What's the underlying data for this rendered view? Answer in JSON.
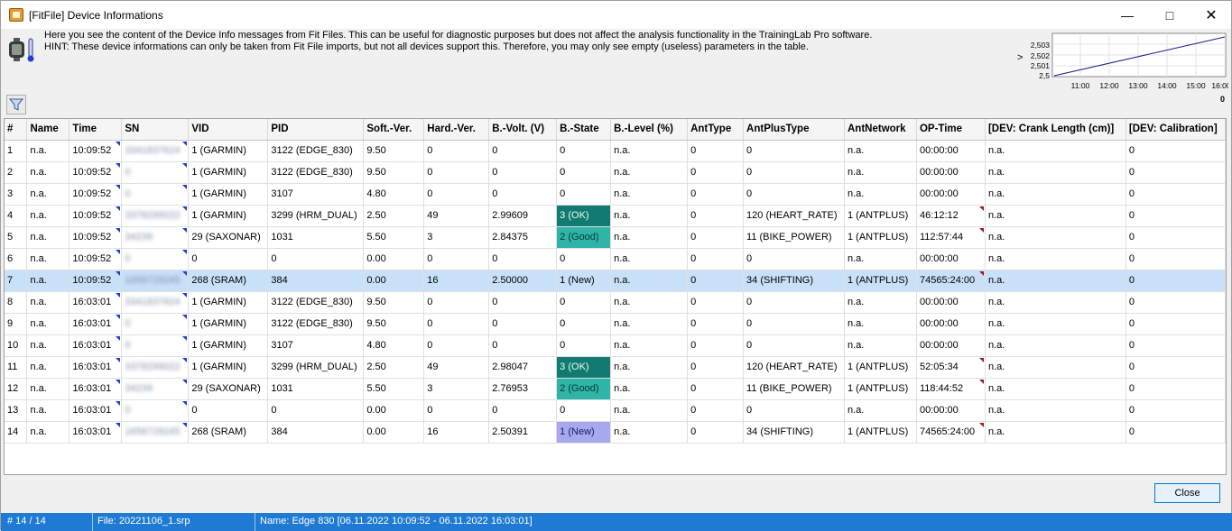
{
  "window": {
    "title": "[FitFile] Device Informations"
  },
  "info": {
    "line1": "Here you see the content of the Device Info messages from Fit Files. This can be useful for diagnostic purposes but does not affect the analysis functionality in the TrainingLab Pro software.",
    "line2": "HINT: These device informations can only be taken from Fit File imports, but not all devices support this. Therefore, you may only see empty (useless) parameters in the table."
  },
  "minichart": {
    "y_ticks": [
      "2,503",
      "2,502",
      "2,501",
      "2,5"
    ],
    "x_ticks": [
      "11:00",
      "12:00",
      "13:00",
      "14:00",
      "15:00",
      "16:00"
    ],
    "corner_label": "0",
    "arrow": ">",
    "line_color": "#1a1a8c"
  },
  "table": {
    "columns": [
      "#",
      "Name",
      "Time",
      "SN",
      "VID",
      "PID",
      "Soft.-Ver.",
      "Hard.-Ver.",
      "B.-Volt. (V)",
      "B.-State",
      "B.-Level (%)",
      "AntType",
      "AntPlusType",
      "AntNetwork",
      "OP-Time",
      "[DEV: Crank Length (cm)]",
      "[DEV: Calibration]"
    ],
    "rows": [
      [
        "1",
        "n.a.",
        "10:09:52",
        "3341837624",
        "1  (GARMIN)",
        "3122  (EDGE_830)",
        "9.50",
        "0",
        "0",
        "0",
        "n.a.",
        "0",
        "0",
        "n.a.",
        "00:00:00",
        "n.a.",
        "0"
      ],
      [
        "2",
        "n.a.",
        "10:09:52",
        "0",
        "1  (GARMIN)",
        "3122  (EDGE_830)",
        "9.50",
        "0",
        "0",
        "0",
        "n.a.",
        "0",
        "0",
        "n.a.",
        "00:00:00",
        "n.a.",
        "0"
      ],
      [
        "3",
        "n.a.",
        "10:09:52",
        "0",
        "1  (GARMIN)",
        "3107",
        "4.80",
        "0",
        "0",
        "0",
        "n.a.",
        "0",
        "0",
        "n.a.",
        "00:00:00",
        "n.a.",
        "0"
      ],
      [
        "4",
        "n.a.",
        "10:09:52",
        "3378299022",
        "1  (GARMIN)",
        "3299  (HRM_DUAL)",
        "2.50",
        "49",
        "2.99609",
        "3  (OK)",
        "n.a.",
        "0",
        "120  (HEART_RATE)",
        "1  (ANTPLUS)",
        "46:12:12",
        "n.a.",
        "0"
      ],
      [
        "5",
        "n.a.",
        "10:09:52",
        "34239",
        "29  (SAXONAR)",
        "1031",
        "5.50",
        "3",
        "2.84375",
        "2  (Good)",
        "n.a.",
        "0",
        "11  (BIKE_POWER)",
        "1  (ANTPLUS)",
        "112:57:44",
        "n.a.",
        "0"
      ],
      [
        "6",
        "n.a.",
        "10:09:52",
        "0",
        "0",
        "0",
        "0.00",
        "0",
        "0",
        "0",
        "n.a.",
        "0",
        "0",
        "n.a.",
        "00:00:00",
        "n.a.",
        "0"
      ],
      [
        "7",
        "n.a.",
        "10:09:52",
        "1658729245",
        "268  (SRAM)",
        "384",
        "0.00",
        "16",
        "2.50000",
        "1  (New)",
        "n.a.",
        "0",
        "34  (SHIFTING)",
        "1  (ANTPLUS)",
        "74565:24:00",
        "n.a.",
        "0"
      ],
      [
        "8",
        "n.a.",
        "16:03:01",
        "3341837624",
        "1  (GARMIN)",
        "3122  (EDGE_830)",
        "9.50",
        "0",
        "0",
        "0",
        "n.a.",
        "0",
        "0",
        "n.a.",
        "00:00:00",
        "n.a.",
        "0"
      ],
      [
        "9",
        "n.a.",
        "16:03:01",
        "0",
        "1  (GARMIN)",
        "3122  (EDGE_830)",
        "9.50",
        "0",
        "0",
        "0",
        "n.a.",
        "0",
        "0",
        "n.a.",
        "00:00:00",
        "n.a.",
        "0"
      ],
      [
        "10",
        "n.a.",
        "16:03:01",
        "0",
        "1  (GARMIN)",
        "3107",
        "4.80",
        "0",
        "0",
        "0",
        "n.a.",
        "0",
        "0",
        "n.a.",
        "00:00:00",
        "n.a.",
        "0"
      ],
      [
        "11",
        "n.a.",
        "16:03:01",
        "3378299022",
        "1  (GARMIN)",
        "3299  (HRM_DUAL)",
        "2.50",
        "49",
        "2.98047",
        "3  (OK)",
        "n.a.",
        "0",
        "120  (HEART_RATE)",
        "1  (ANTPLUS)",
        "52:05:34",
        "n.a.",
        "0"
      ],
      [
        "12",
        "n.a.",
        "16:03:01",
        "34239",
        "29  (SAXONAR)",
        "1031",
        "5.50",
        "3",
        "2.76953",
        "2  (Good)",
        "n.a.",
        "0",
        "11  (BIKE_POWER)",
        "1  (ANTPLUS)",
        "118:44:52",
        "n.a.",
        "0"
      ],
      [
        "13",
        "n.a.",
        "16:03:01",
        "0",
        "0",
        "0",
        "0.00",
        "0",
        "0",
        "0",
        "n.a.",
        "0",
        "0",
        "n.a.",
        "00:00:00",
        "n.a.",
        "0"
      ],
      [
        "14",
        "n.a.",
        "16:03:01",
        "1658729245",
        "268  (SRAM)",
        "384",
        "0.00",
        "16",
        "2.50391",
        "1  (New)",
        "n.a.",
        "0",
        "34  (SHIFTING)",
        "1  (ANTPLUS)",
        "74565:24:00",
        "n.a.",
        "0"
      ]
    ],
    "selected_row": 7
  },
  "buttons": {
    "close": "Close"
  },
  "status": {
    "count": "# 14 / 14",
    "file": "File: 20221106_1.srp",
    "name": "Name: Edge 830 [06.11.2022 10:09:52 - 06.11.2022 16:03:01]"
  }
}
